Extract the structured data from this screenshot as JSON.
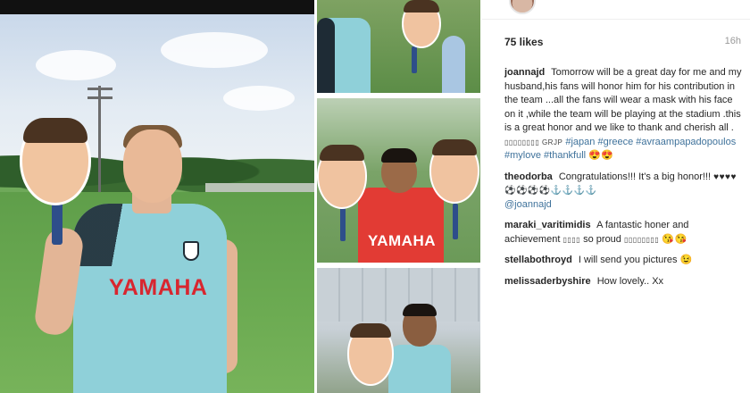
{
  "post": {
    "likes": "75 likes",
    "time": "16h",
    "brand_color": "#3f729b",
    "sponsor_text": "YAMAHA"
  },
  "comments": [
    {
      "username": "joannajd",
      "text": "Tomorrow will be a great day for me and my husband,his fans will honor him for his contribution in the team ...all the fans will wear a mask with his face on it ,while the team will be playing at the stadium .this is a great honor and we like to thank and cherish all .",
      "emoji": "▯▯▯▯▯▯▯▯ GRJP",
      "hashtags": [
        "#japan",
        "#greece",
        "#avraampapadopoulos",
        "#mylove",
        "#thankfull"
      ],
      "tail_emoji": "😍😍"
    },
    {
      "username": "theodorba",
      "text": "Congratulations!!! It's a big honor!!!",
      "emoji": "♥♥♥♥⚽⚽⚽⚽⚓⚓⚓⚓",
      "mention": "@joannajd"
    },
    {
      "username": "maraki_varitimidis",
      "text": "A fantastic honer and achievement",
      "emoji": "▯▯▯▯",
      "text2": "so proud",
      "emoji2": "▯▯▯▯▯▯▯▯",
      "tail_emoji": "😘😘"
    },
    {
      "username": "stellabothroyd",
      "text": "I will send you pictures",
      "tail_emoji": "😉"
    },
    {
      "username": "melissaderbyshire",
      "text": "How lovely.. Xx"
    }
  ]
}
